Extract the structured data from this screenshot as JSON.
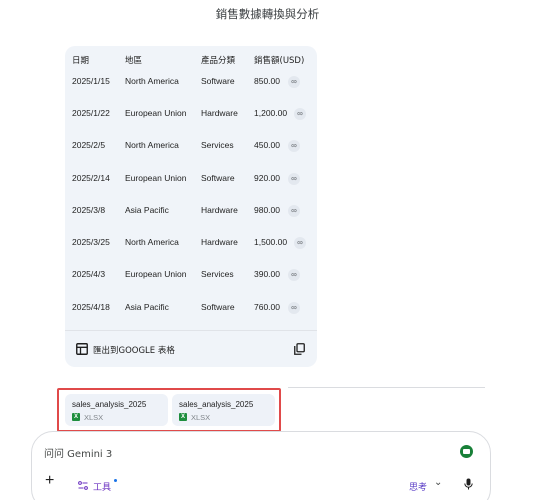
{
  "header": {
    "title": "銷售數據轉換與分析"
  },
  "table": {
    "headers": [
      "日期",
      "地區",
      "產品分類",
      "銷售額(USD)"
    ],
    "rows": [
      [
        "2025/1/15",
        "North America",
        "Software",
        "850.00"
      ],
      [
        "2025/1/22",
        "European Union",
        "Hardware",
        "1,200.00"
      ],
      [
        "2025/2/5",
        "North America",
        "Services",
        "450.00"
      ],
      [
        "2025/2/14",
        "European Union",
        "Software",
        "920.00"
      ],
      [
        "2025/3/8",
        "Asia Pacific",
        "Hardware",
        "980.00"
      ],
      [
        "2025/3/25",
        "North America",
        "Hardware",
        "1,500.00"
      ],
      [
        "2025/4/3",
        "European Union",
        "Services",
        "390.00"
      ],
      [
        "2025/4/18",
        "Asia Pacific",
        "Software",
        "760.00"
      ]
    ]
  },
  "export": {
    "label": "匯出到GOOGLE 表格"
  },
  "files": [
    {
      "name": "sales_analysis_2025",
      "type": "XLSX"
    },
    {
      "name": "sales_analysis_2025",
      "type": "XLSX"
    }
  ],
  "composer": {
    "placeholder": "问问 Gemini 3",
    "add_label": "+",
    "tools_label": "工具",
    "mode_label": "思考"
  },
  "colors": {
    "highlight_border": "#e04a4a",
    "tools_accent": "#6b32c0",
    "card_bg": "#f0f4f9"
  }
}
